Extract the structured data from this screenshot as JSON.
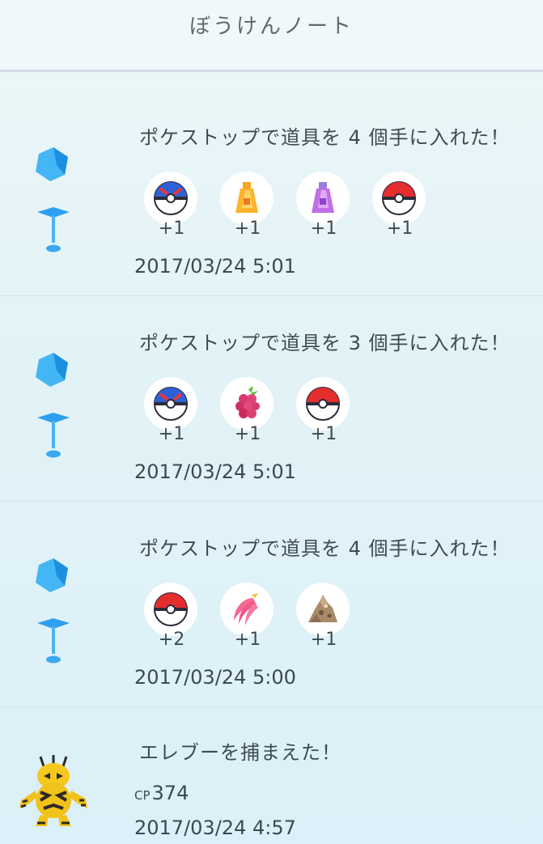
{
  "header": {
    "title": "ぼうけんノート"
  },
  "entries": [
    {
      "type": "pokestop",
      "text": "ポケストップで道具を 4 個手に入れた！",
      "items": [
        {
          "icon": "great-ball-icon",
          "count": "+1"
        },
        {
          "icon": "potion-icon",
          "count": "+1"
        },
        {
          "icon": "super-potion-icon",
          "count": "+1"
        },
        {
          "icon": "poke-ball-icon",
          "count": "+1"
        }
      ],
      "timestamp": "2017/03/24 5:01"
    },
    {
      "type": "pokestop",
      "text": "ポケストップで道具を 3 個手に入れた！",
      "items": [
        {
          "icon": "great-ball-icon",
          "count": "+1"
        },
        {
          "icon": "razz-berry-icon",
          "count": "+1"
        },
        {
          "icon": "poke-ball-icon",
          "count": "+1"
        }
      ],
      "timestamp": "2017/03/24 5:01"
    },
    {
      "type": "pokestop",
      "text": "ポケストップで道具を 4 個手に入れた！",
      "items": [
        {
          "icon": "poke-ball-icon",
          "count": "+2"
        },
        {
          "icon": "nanab-berry-icon",
          "count": "+1"
        },
        {
          "icon": "evolution-item-icon",
          "count": "+1"
        }
      ],
      "timestamp": "2017/03/24 5:00"
    },
    {
      "type": "catch",
      "text": "エレブーを捕まえた！",
      "cp_label": "CP",
      "cp_value": "374",
      "timestamp": "2017/03/24 4:57"
    }
  ],
  "colors": {
    "pokestop_blue": "#3aa8f0",
    "background": "#e3f3f7",
    "text": "#3b4a50"
  }
}
